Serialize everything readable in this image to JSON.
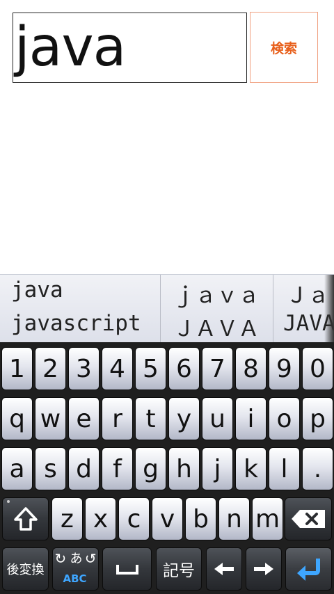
{
  "search": {
    "value": "java",
    "button_label": "検索"
  },
  "candidates": [
    [
      "java",
      "javascript"
    ],
    [
      "ｊａｖａ",
      "ＪＡＶＡ"
    ],
    [
      "Ｊａ",
      "JAVA"
    ]
  ],
  "keyboard": {
    "row_numbers": [
      "1",
      "2",
      "3",
      "4",
      "5",
      "6",
      "7",
      "8",
      "9",
      "0"
    ],
    "row_q": [
      "q",
      "w",
      "e",
      "r",
      "t",
      "y",
      "u",
      "i",
      "o",
      "p"
    ],
    "row_a": [
      "a",
      "s",
      "d",
      "f",
      "g",
      "h",
      "j",
      "k",
      "l",
      "."
    ],
    "row_z": [
      "z",
      "x",
      "c",
      "v",
      "b",
      "n",
      "m"
    ],
    "convert_label": "後変換",
    "mode_label_top": "あ",
    "mode_label_bottom": "ABC",
    "symbol_label": "記号"
  },
  "colors": {
    "search_button_text": "#e8601c",
    "enter_arrow": "#3ea6ff"
  }
}
